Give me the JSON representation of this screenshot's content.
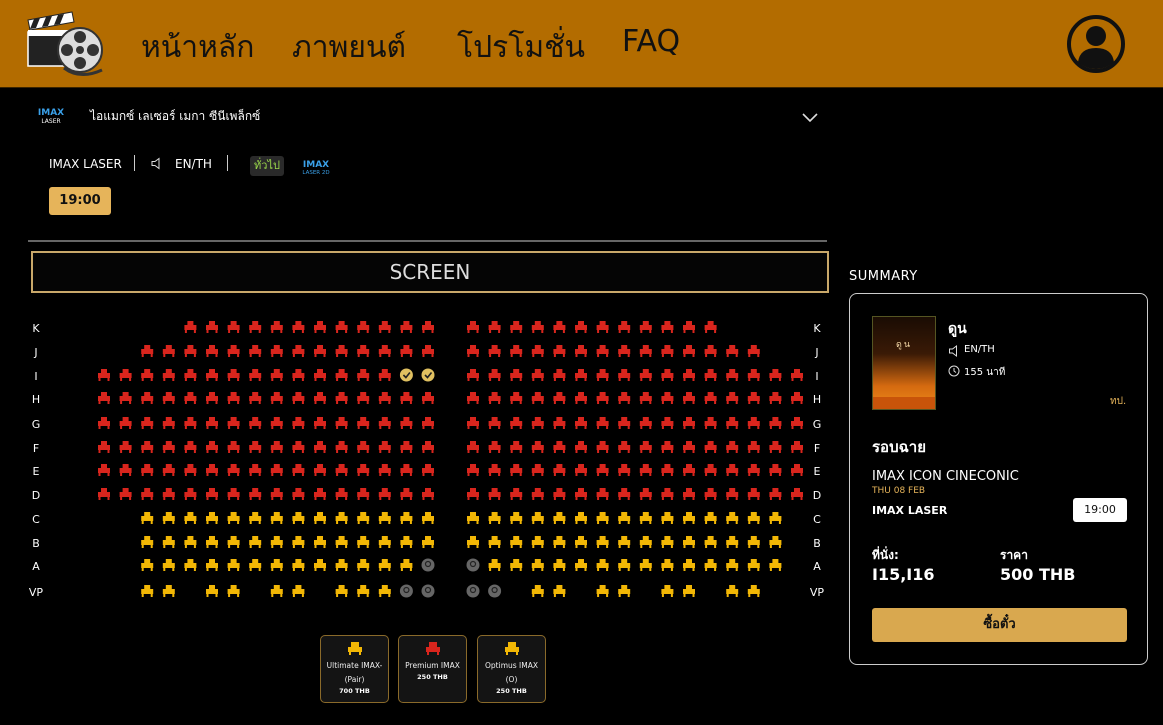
{
  "nav": {
    "items": [
      "หน้าหลัก",
      "ภาพยนต์",
      "โปรโมชั่น",
      "FAQ"
    ]
  },
  "cinema": {
    "logo_text": "IMAX LASER",
    "name": "ไอแมกซ์ เลเซอร์ เมกา ซีนีเพล็กซ์",
    "format": "IMAX LASER",
    "language": "EN/TH",
    "rating": "ทั่วไป",
    "format_badge": "IMAX LASER 2D",
    "showtime": "19:00"
  },
  "screen_label": "SCREEN",
  "seat_rows": [
    {
      "label": "K",
      "type": "premium"
    },
    {
      "label": "J",
      "type": "premium"
    },
    {
      "label": "I",
      "type": "premium"
    },
    {
      "label": "H",
      "type": "premium"
    },
    {
      "label": "G",
      "type": "premium"
    },
    {
      "label": "F",
      "type": "premium"
    },
    {
      "label": "E",
      "type": "premium"
    },
    {
      "label": "D",
      "type": "premium"
    },
    {
      "label": "C",
      "type": "optimus"
    },
    {
      "label": "B",
      "type": "optimus"
    },
    {
      "label": "A",
      "type": "optimus"
    },
    {
      "label": "VP",
      "type": "ultimate"
    }
  ],
  "selected_seats": [
    "I15",
    "I16"
  ],
  "legend": [
    {
      "name": "Ultimate IMAX-(Pair)",
      "price": "700 THB",
      "color": "#f2b705"
    },
    {
      "name": "Premium IMAX",
      "price": "250 THB",
      "color": "#d9251d"
    },
    {
      "name": "Optimus IMAX (O)",
      "price": "250 THB",
      "color": "#f2b705"
    }
  ],
  "colors": {
    "nav_bg": "#b36c00",
    "premium": "#d9251d",
    "optimus": "#f2b705",
    "selected": "#e0c060",
    "unavailable": "#666666",
    "accent": "#d9a84f"
  },
  "summary": {
    "title": "SUMMARY",
    "poster_title": "ดูน",
    "movie": "ดูน",
    "language": "EN/TH",
    "duration": "155 นาที",
    "rating": "ทป.",
    "showtime_heading": "รอบฉาย",
    "cinema": "IMAX ICON CINECONIC",
    "date": "THU 08 FEB",
    "format": "IMAX LASER",
    "time": "19:00",
    "seat_label": "ที่นั่ง:",
    "seats": "I15,I16",
    "price_label": "ราคา",
    "price": "500 THB",
    "buy_label": "ซื้อตั๋ว"
  }
}
